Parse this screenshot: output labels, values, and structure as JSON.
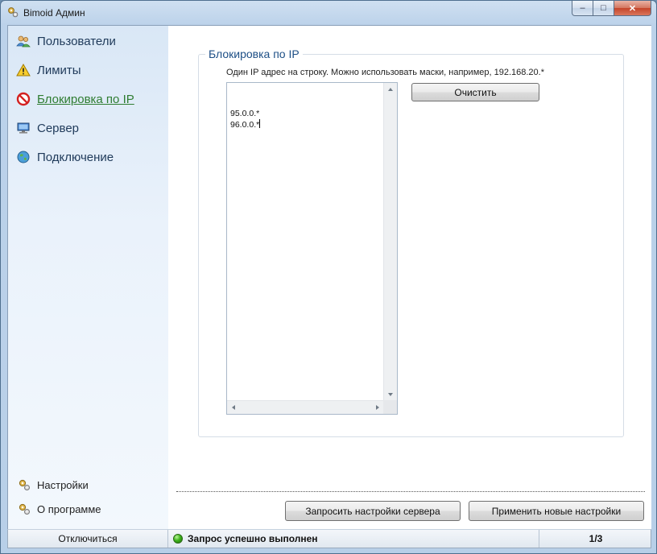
{
  "window": {
    "title": "Bimoid Админ",
    "controls": {
      "minimize": "–",
      "maximize": "□",
      "close": "✕"
    }
  },
  "sidebar": {
    "items": [
      {
        "label": "Пользователи",
        "icon": "users-icon"
      },
      {
        "label": "Лимиты",
        "icon": "warning-icon"
      },
      {
        "label": "Блокировка по IP",
        "icon": "block-icon",
        "active": true
      },
      {
        "label": "Сервер",
        "icon": "monitor-icon"
      },
      {
        "label": "Подключение",
        "icon": "globe-icon"
      }
    ],
    "bottom_items": [
      {
        "label": "Настройки",
        "icon": "gears-icon"
      },
      {
        "label": "О программе",
        "icon": "gears-icon"
      }
    ]
  },
  "ip_block": {
    "group_title": "Блокировка по IP",
    "hint": "Один IP адрес на строку. Можно использовать маски, например, 192.168.20.*",
    "entries": [
      "95.0.0.*",
      "96.0.0.*"
    ],
    "clear_label": "Очистить"
  },
  "footer": {
    "request_label": "Запросить настройки сервера",
    "apply_label": "Применить новые настройки"
  },
  "statusbar": {
    "disconnect_label": "Отключиться",
    "status_text": "Запрос успешно выполнен",
    "page": "1/3"
  },
  "colors": {
    "active_nav": "#2f7d32",
    "group_title": "#1d4f86",
    "status_ok": "#3fb41c"
  }
}
